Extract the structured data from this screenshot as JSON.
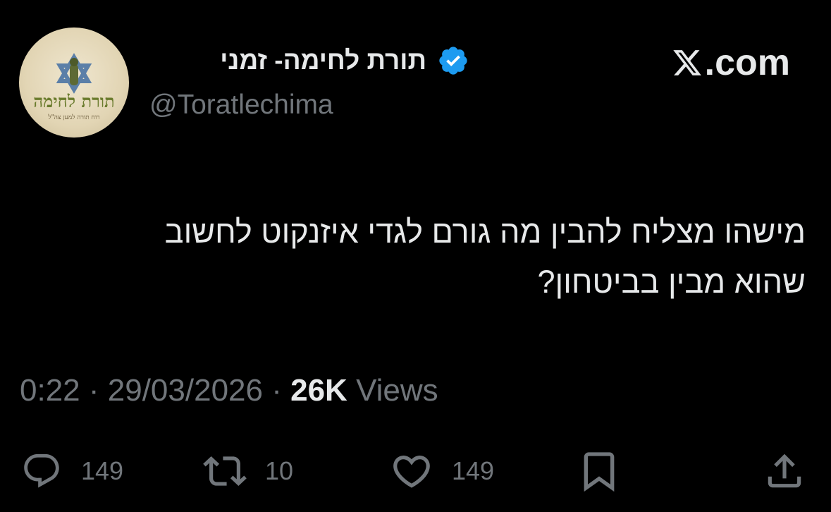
{
  "tweet": {
    "author": {
      "display_name": "תורת לחימה- זמני",
      "handle": "@Toratlechima",
      "verified": true,
      "badge_color": "#1d9bf0",
      "avatar": {
        "logo_title": "תורת לחימה",
        "logo_subtitle": "רוח תורה למען צה\"ל"
      }
    },
    "brand": "X.com",
    "text_lines": [
      "מישהו מצליח להבין מה גורם לגדי איזנקוט לחשוב",
      "שהוא מבין בביטחון?"
    ],
    "time": "0:22",
    "separator": "·",
    "date": "29/03/2026",
    "views_count": "26K",
    "views_label": "Views",
    "actions": {
      "replies": "149",
      "reposts": "10",
      "likes": "149"
    },
    "icons": [
      "reply-icon",
      "repost-icon",
      "like-icon",
      "bookmark-icon",
      "share-icon"
    ],
    "colors": {
      "background": "#000000",
      "text": "#e7e9ea",
      "secondary": "#71767b",
      "accent": "#1d9bf0"
    }
  }
}
